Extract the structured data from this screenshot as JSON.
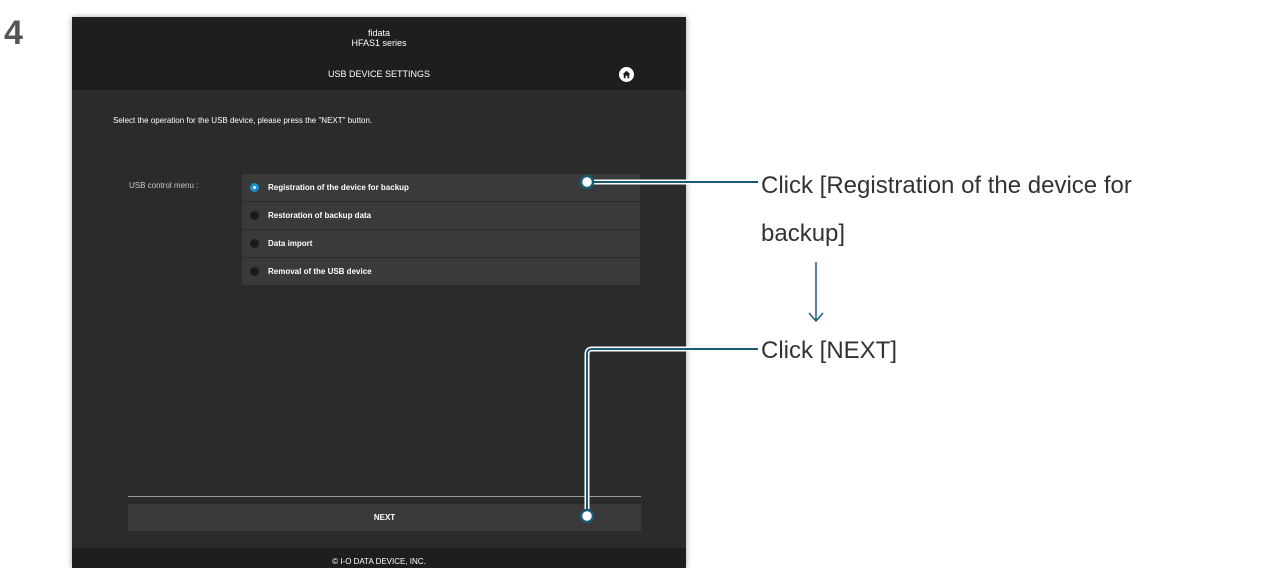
{
  "step_number": "4",
  "app": {
    "brand": "fidata",
    "model": "HFAS1 series",
    "screen_title": "USB DEVICE SETTINGS",
    "home_icon": "home-icon"
  },
  "instruction": "Select the operation for the USB device, please press the \"NEXT\" button.",
  "usb_menu": {
    "label": "USB control menu :",
    "items": [
      {
        "label": "Registration of the device for backup",
        "selected": true
      },
      {
        "label": "Restoration of backup data",
        "selected": false
      },
      {
        "label": "Data import",
        "selected": false
      },
      {
        "label": "Removal of the USB device",
        "selected": false
      }
    ]
  },
  "next_button": "NEXT",
  "footer": "© I-O DATA DEVICE, INC.",
  "callouts": {
    "first_line1": "Click [Registration of the device for",
    "first_line2": "backup]",
    "second": "Click [NEXT]"
  },
  "colors": {
    "accent": "#1c8ed0",
    "callout_line": "#1b5a73",
    "background": "#2b2b2b"
  }
}
